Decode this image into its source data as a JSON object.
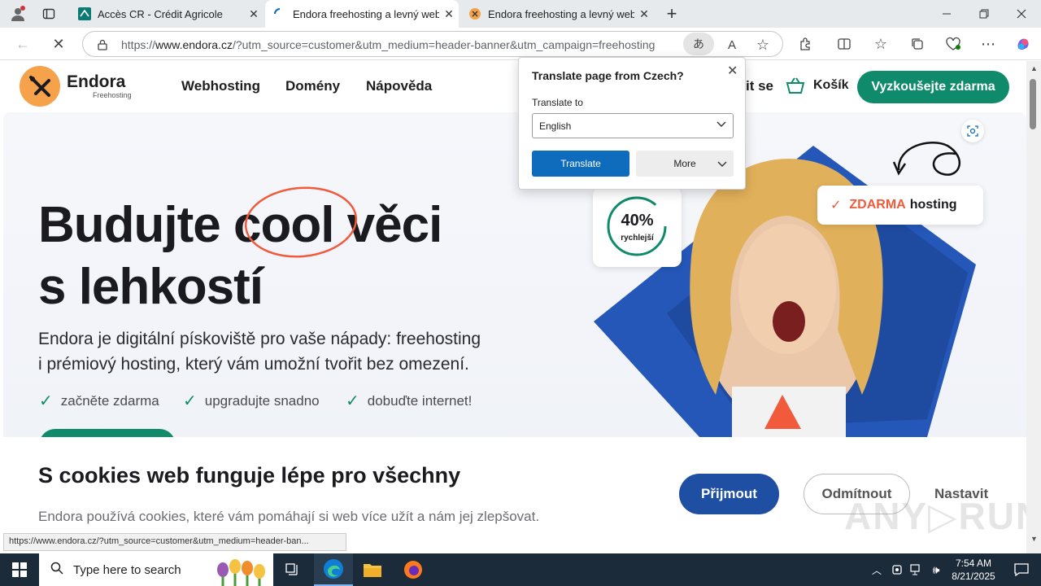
{
  "browser": {
    "tabs": [
      {
        "title": "Accès CR - Crédit Agricole",
        "active": false
      },
      {
        "title": "Endora freehosting a levný webho",
        "active": true
      },
      {
        "title": "Endora freehosting a levný webho",
        "active": false
      }
    ],
    "url_prefix": "https://",
    "url_host": "www.endora.cz",
    "url_rest": "/?utm_source=customer&utm_medium=header-banner&utm_campaign=freehosting",
    "status_url": "https://www.endora.cz/?utm_source=customer&utm_medium=header-ban..."
  },
  "site": {
    "logo": "Endora",
    "logo_sub": "Freehosting",
    "nav": [
      "Webhosting",
      "Domény",
      "Nápověda"
    ],
    "login_fragment": "it se",
    "cart": "Košík",
    "cta": "Vyzkoušejte zdarma",
    "headline_1": "Budujte",
    "headline_cool": "cool",
    "headline_2": "věci",
    "headline_3": "s lehkostí",
    "lead_1": "Endora je digitální pískoviště pro vaše nápady: freehosting",
    "lead_2": "i prémiový hosting, který vám umožní tvořit bez omezení.",
    "checks": [
      "začněte zdarma",
      "upgradujte snadno",
      "dobuďte internet!"
    ],
    "badge_percent": "40%",
    "badge_label": "rychlejší",
    "badge_free_1": "ZDARMA",
    "badge_free_2": "hosting"
  },
  "cookie": {
    "title": "S cookies web funguje lépe pro všechny",
    "text": "Endora používá cookies, které vám pomáhají si web více užít a nám jej zlepšovat.",
    "accept": "Přijmout",
    "reject": "Odmítnout",
    "settings": "Nastavit"
  },
  "translate": {
    "title": "Translate page from Czech?",
    "label": "Translate to",
    "language": "English",
    "button": "Translate",
    "more": "More"
  },
  "taskbar": {
    "search_placeholder": "Type here to search",
    "time": "7:54 AM",
    "date": "8/21/2025"
  },
  "colors": {
    "brand_green": "#0f8a6a",
    "brand_orange": "#f5a24b",
    "brand_blue": "#1f4fa3",
    "translate_blue": "#0f6cbd"
  }
}
